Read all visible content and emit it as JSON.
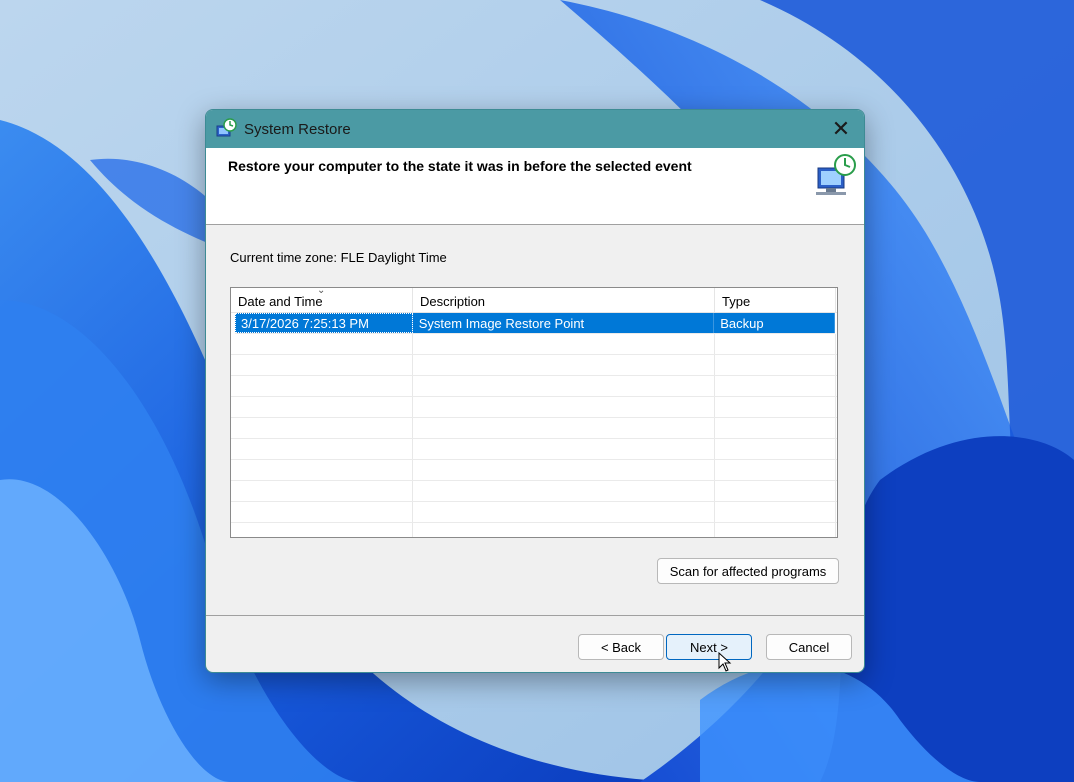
{
  "window": {
    "title": "System Restore",
    "close_glyph": "✕"
  },
  "header": {
    "heading": "Restore your computer to the state it was in before the selected event"
  },
  "timezone": {
    "label": "Current time zone:",
    "value": "FLE Daylight Time"
  },
  "table": {
    "columns": [
      "Date and Time",
      "Description",
      "Type"
    ],
    "rows": [
      {
        "date": "3/17/2026 7:25:13 PM",
        "description": "System Image Restore Point",
        "type": "Backup"
      }
    ]
  },
  "buttons": {
    "scan": "Scan for affected programs",
    "back": "< Back",
    "next": "Next >",
    "cancel": "Cancel"
  },
  "icons": {
    "app": "system-restore-icon",
    "header": "restore-computer-icon",
    "close": "close-icon"
  },
  "colors": {
    "titlebar": "#4b9aa4",
    "selection": "#0078d7",
    "accent_button_border": "#0067c0"
  }
}
